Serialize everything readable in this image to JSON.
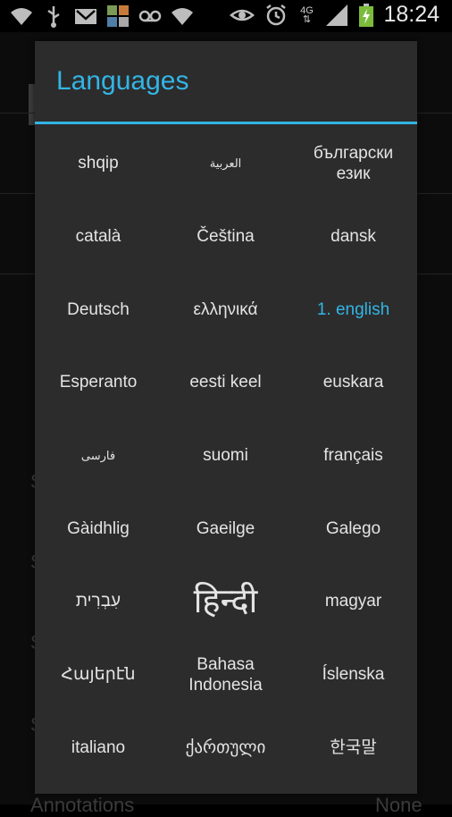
{
  "status_bar": {
    "time": "18:24",
    "network_type": "4G",
    "left_icons": [
      "wifi-icon",
      "usb-icon",
      "gmail-icon",
      "app-grid-icon",
      "voicemail-icon",
      "wifi-icon"
    ],
    "right_icons": [
      "eye-icon",
      "alarm-icon",
      "network-4g-icon",
      "signal-icon",
      "battery-charging-icon"
    ]
  },
  "background": {
    "bottom_label": "Annotations",
    "bottom_value": "None",
    "side_letters": [
      "S",
      "S",
      "S",
      "S"
    ]
  },
  "dialog": {
    "title": "Languages",
    "accent_color": "#33b5e5",
    "languages": [
      {
        "label": "shqip"
      },
      {
        "label": "العربية"
      },
      {
        "label": "български език"
      },
      {
        "label": "català"
      },
      {
        "label": "Čeština"
      },
      {
        "label": "dansk"
      },
      {
        "label": "Deutsch"
      },
      {
        "label": "ελληνικά"
      },
      {
        "label": "1. english",
        "selected": true
      },
      {
        "label": "Esperanto"
      },
      {
        "label": "eesti keel"
      },
      {
        "label": "euskara"
      },
      {
        "label": "فارسی"
      },
      {
        "label": "suomi"
      },
      {
        "label": "français"
      },
      {
        "label": "Gàidhlig"
      },
      {
        "label": "Gaeilge"
      },
      {
        "label": "Galego"
      },
      {
        "label": "עִבְרִית"
      },
      {
        "label": "हिन्दी"
      },
      {
        "label": "magyar"
      },
      {
        "label": "Հայերէն"
      },
      {
        "label": "Bahasa Indonesia"
      },
      {
        "label": "Íslenska"
      },
      {
        "label": "italiano"
      },
      {
        "label": "ქართული"
      },
      {
        "label": "한국말"
      }
    ]
  }
}
